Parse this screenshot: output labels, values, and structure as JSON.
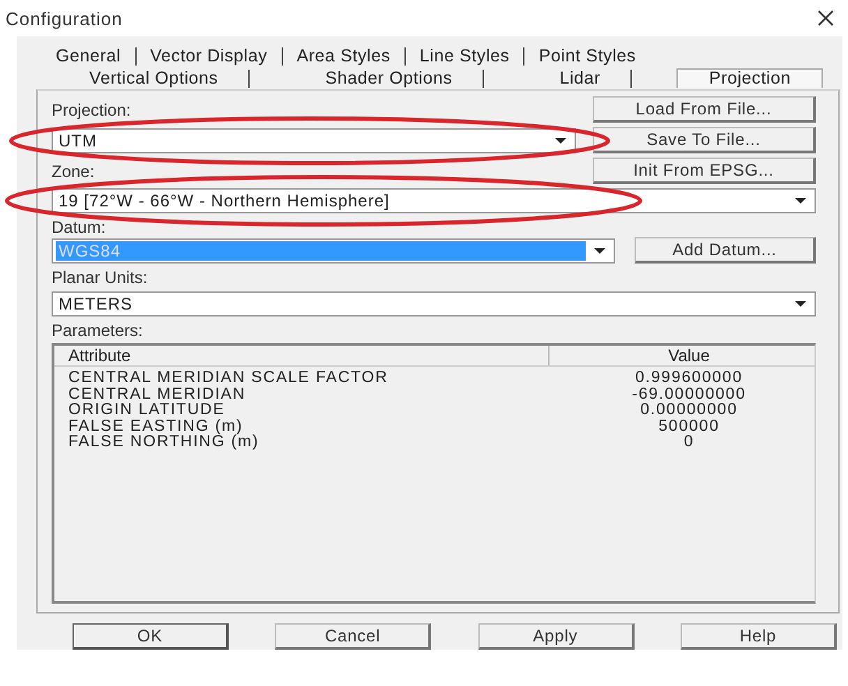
{
  "window": {
    "title": "Configuration"
  },
  "tab_rows": [
    [
      {
        "label": "General",
        "selected": false
      },
      {
        "label": "Vector Display",
        "selected": false
      },
      {
        "label": "Area Styles",
        "selected": false
      },
      {
        "label": "Line Styles",
        "selected": false
      },
      {
        "label": "Point Styles",
        "selected": false
      }
    ],
    [
      {
        "label": "Vertical Options",
        "selected": false
      },
      {
        "label": "Shader Options",
        "selected": false
      },
      {
        "label": "Lidar",
        "selected": false
      },
      {
        "label": "Projection",
        "selected": true
      }
    ]
  ],
  "projection": {
    "label": "Projection:",
    "value": "UTM",
    "highlighted": false
  },
  "side_buttons": [
    "Load From File...",
    "Save To File...",
    "Init From EPSG..."
  ],
  "zone": {
    "label": "Zone:",
    "value": "19 [72°W - 66°W - Northern Hemisphere]",
    "highlighted": false
  },
  "datum": {
    "label": "Datum:",
    "value": "WGS84",
    "highlighted": true
  },
  "add_datum_button": "Add Datum...",
  "planar_units": {
    "label": "Planar Units:",
    "value": "METERS",
    "highlighted": false
  },
  "parameters": {
    "label": "Parameters:",
    "columns": [
      "Attribute",
      "Value"
    ],
    "rows": [
      {
        "attribute": "CENTRAL MERIDIAN SCALE FACTOR",
        "value": "0.999600000"
      },
      {
        "attribute": "CENTRAL MERIDIAN",
        "value": "-69.00000000"
      },
      {
        "attribute": "ORIGIN LATITUDE",
        "value": "0.00000000"
      },
      {
        "attribute": "FALSE EASTING (m)",
        "value": "500000"
      },
      {
        "attribute": "FALSE NORTHING (m)",
        "value": "0"
      }
    ]
  },
  "buttons": [
    {
      "label": "OK",
      "default": true
    },
    {
      "label": "Cancel",
      "default": false
    },
    {
      "label": "Apply",
      "default": false
    },
    {
      "label": "Help",
      "default": false
    }
  ]
}
